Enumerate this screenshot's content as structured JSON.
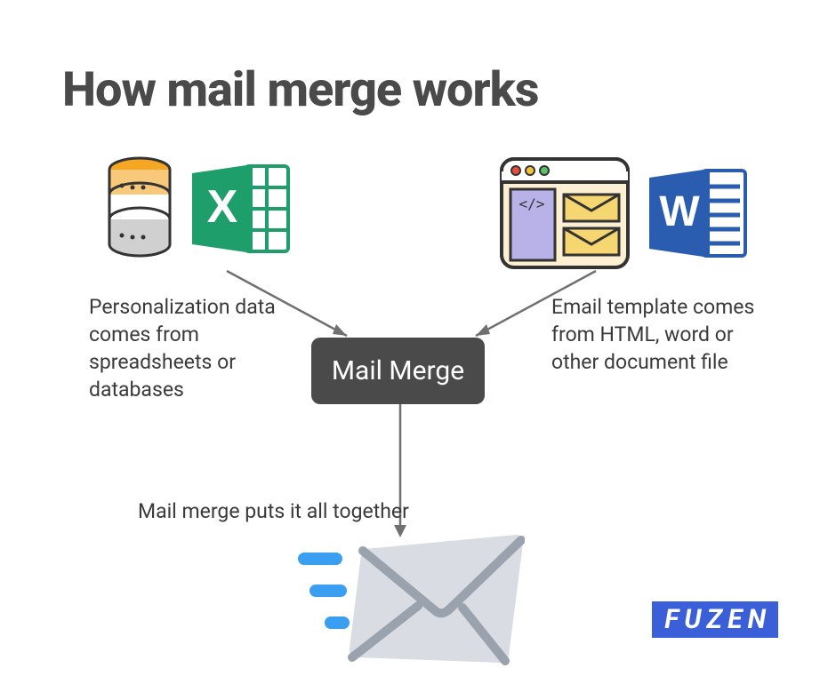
{
  "title": "How mail merge works",
  "left_caption": "Personalization data comes from spreadsheets or databases",
  "right_caption": "Email template comes from HTML, word or other document file",
  "center_label": "Mail Merge",
  "bottom_caption": "Mail merge puts it all together",
  "logo_text": "FUZEN",
  "icons": {
    "database": "database-icon",
    "excel": "excel-icon",
    "excel_letter": "X",
    "html_window": "html-window-icon",
    "word": "word-icon",
    "word_letter": "W",
    "envelope": "envelope-send-icon"
  },
  "colors": {
    "excel_green": "#1e9e6a",
    "word_blue": "#2a5cb0",
    "db_orange": "#f5a623",
    "db_gray": "#c9c9c9",
    "logo_bg": "#3a5fd9",
    "arrow": "#707070",
    "center_box": "#4a4a4a",
    "envelope_body": "#d9dde3",
    "envelope_line": "#9aa2ad",
    "speed_blue": "#3a9ff0"
  }
}
